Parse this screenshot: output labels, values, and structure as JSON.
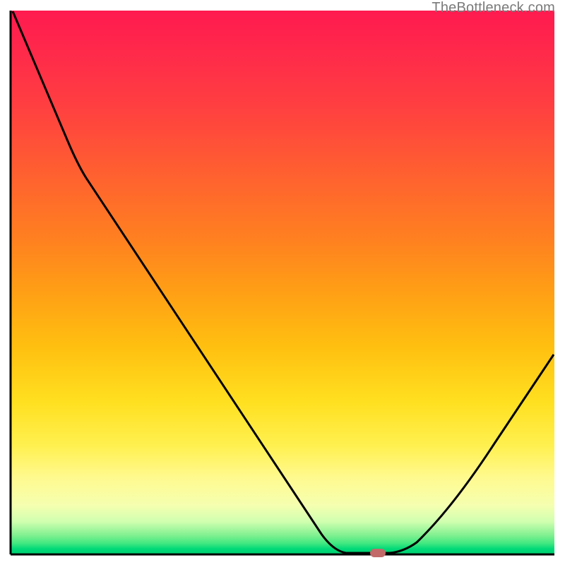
{
  "watermark": "TheBottleneck.com",
  "colors": {
    "axis": "#000000",
    "curve": "#000000",
    "marker": "#c26a6a"
  },
  "chart_data": {
    "type": "line",
    "title": "",
    "xlabel": "",
    "ylabel": "",
    "x_range": [
      0,
      100
    ],
    "y_range": [
      0,
      100
    ],
    "series": [
      {
        "name": "bottleneck-curve",
        "points": [
          {
            "x": 0.5,
            "y": 99.5
          },
          {
            "x": 10.5,
            "y": 76
          },
          {
            "x": 12,
            "y": 72
          },
          {
            "x": 13.5,
            "y": 69
          },
          {
            "x": 57,
            "y": 4
          },
          {
            "x": 60,
            "y": 1
          },
          {
            "x": 63,
            "y": 0
          },
          {
            "x": 70,
            "y": 0
          },
          {
            "x": 73,
            "y": 1
          },
          {
            "x": 78,
            "y": 6
          },
          {
            "x": 99.5,
            "y": 37
          }
        ]
      }
    ],
    "marker": {
      "x": 67.5,
      "y": 0
    },
    "background_gradient": {
      "stops": [
        {
          "offset": 0,
          "color": "#ff1a4f"
        },
        {
          "offset": 50,
          "color": "#ffa015"
        },
        {
          "offset": 80,
          "color": "#fff050"
        },
        {
          "offset": 100,
          "color": "#00d070"
        }
      ]
    }
  }
}
